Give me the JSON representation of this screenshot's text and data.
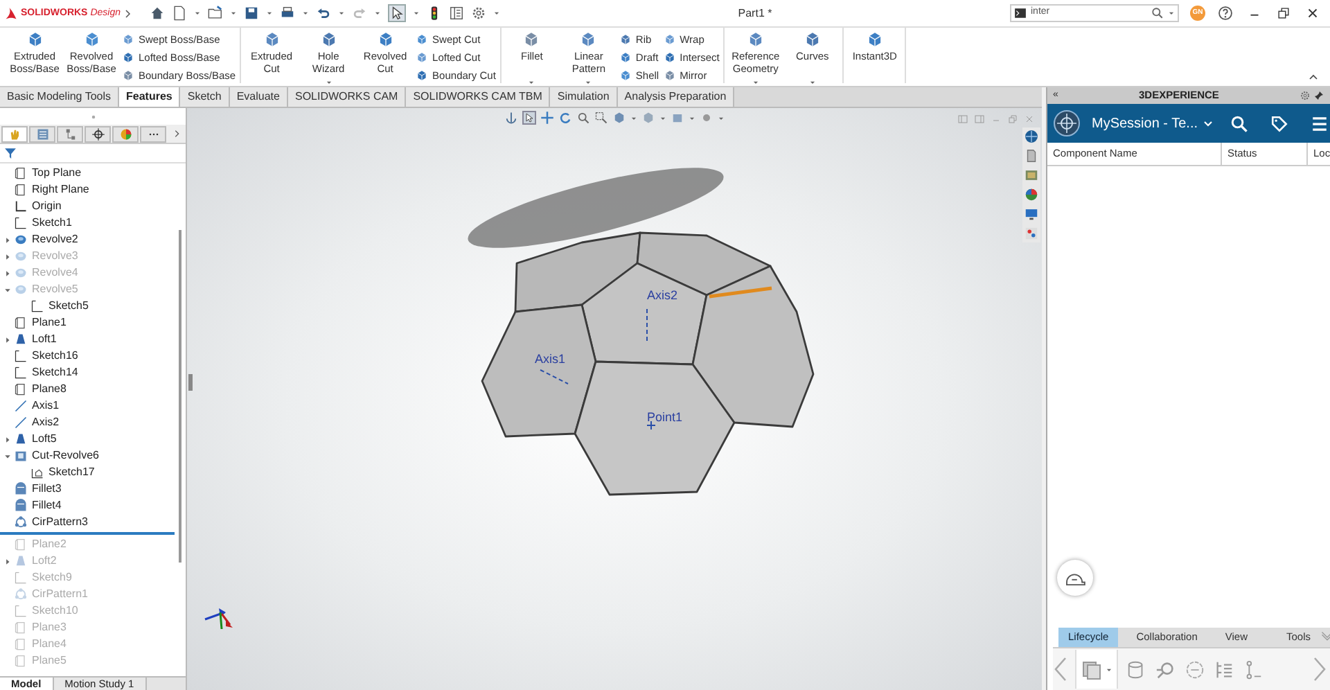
{
  "title_bar": {
    "logo": {
      "brand": "SOLIDWORKS",
      "product": "Design"
    },
    "document_title": "Part1 *",
    "search": {
      "value": "inter"
    },
    "avatar": "GN"
  },
  "ribbon": {
    "groups": [
      {
        "columns": [
          {
            "kind": "large",
            "label": "Extruded Boss/Base"
          },
          {
            "kind": "large",
            "label": "Revolved Boss/Base"
          },
          {
            "kind": "stack",
            "items": [
              "Swept Boss/Base",
              "Lofted Boss/Base",
              "Boundary Boss/Base"
            ]
          }
        ]
      },
      {
        "columns": [
          {
            "kind": "large",
            "label": "Extruded Cut"
          },
          {
            "kind": "large",
            "label": "Hole Wizard",
            "dropdown": true
          },
          {
            "kind": "large",
            "label": "Revolved Cut"
          },
          {
            "kind": "stack",
            "items": [
              "Swept Cut",
              "Lofted Cut",
              "Boundary Cut"
            ]
          }
        ]
      },
      {
        "columns": [
          {
            "kind": "large",
            "label": "Fillet",
            "dropdown": true
          },
          {
            "kind": "large",
            "label": "Linear Pattern",
            "dropdown": true
          },
          {
            "kind": "stack",
            "items": [
              "Rib",
              "Draft",
              "Shell"
            ]
          },
          {
            "kind": "stack",
            "items": [
              "Wrap",
              "Intersect",
              "Mirror"
            ]
          }
        ]
      },
      {
        "columns": [
          {
            "kind": "large",
            "label": "Reference Geometry",
            "dropdown": true
          },
          {
            "kind": "large",
            "label": "Curves",
            "dropdown": true
          }
        ]
      },
      {
        "columns": [
          {
            "kind": "large",
            "label": "Instant3D"
          }
        ]
      }
    ]
  },
  "command_tabs": [
    {
      "label": "Basic Modeling Tools",
      "selected": false
    },
    {
      "label": "Features",
      "selected": true
    },
    {
      "label": "Sketch",
      "selected": false
    },
    {
      "label": "Evaluate",
      "selected": false
    },
    {
      "label": "SOLIDWORKS CAM",
      "selected": false
    },
    {
      "label": "SOLIDWORKS CAM TBM",
      "selected": false
    },
    {
      "label": "Simulation",
      "selected": false
    },
    {
      "label": "Analysis Preparation",
      "selected": false
    }
  ],
  "panel_tabs": [
    {
      "selected": true
    },
    {
      "selected": false
    },
    {
      "selected": false
    },
    {
      "selected": false
    },
    {
      "selected": false
    },
    {
      "selected": false
    }
  ],
  "feature_tree": [
    {
      "label": "Top Plane",
      "kind": "plane",
      "greyed": false
    },
    {
      "label": "Right Plane",
      "kind": "plane",
      "greyed": false
    },
    {
      "label": "Origin",
      "kind": "origin",
      "greyed": false
    },
    {
      "label": "Sketch1",
      "kind": "sketch",
      "greyed": false
    },
    {
      "label": "Revolve2",
      "kind": "revolve",
      "greyed": false,
      "expanded": false
    },
    {
      "label": "Revolve3",
      "kind": "revolve",
      "greyed": true,
      "expanded": false
    },
    {
      "label": "Revolve4",
      "kind": "revolve",
      "greyed": true,
      "expanded": false
    },
    {
      "label": "Revolve5",
      "kind": "revolve",
      "greyed": true,
      "expanded": true,
      "children": [
        {
          "label": "Sketch5",
          "kind": "sketch",
          "greyed": false
        }
      ]
    },
    {
      "label": "Plane1",
      "kind": "plane",
      "greyed": false
    },
    {
      "label": "Loft1",
      "kind": "loft",
      "greyed": false,
      "expanded": false
    },
    {
      "label": "Sketch16",
      "kind": "sketch",
      "greyed": false
    },
    {
      "label": "Sketch14",
      "kind": "sketch",
      "greyed": false
    },
    {
      "label": "Plane8",
      "kind": "plane",
      "greyed": false
    },
    {
      "label": "Axis1",
      "kind": "axis",
      "greyed": false
    },
    {
      "label": "Axis2",
      "kind": "axis",
      "greyed": false
    },
    {
      "label": "Loft5",
      "kind": "loft",
      "greyed": false,
      "expanded": false
    },
    {
      "label": "Cut-Revolve6",
      "kind": "cut",
      "greyed": false,
      "expanded": true,
      "children": [
        {
          "label": "Sketch17",
          "kind": "sketch3d",
          "greyed": false
        }
      ]
    },
    {
      "label": "Fillet3",
      "kind": "fillet",
      "greyed": false
    },
    {
      "label": "Fillet4",
      "kind": "fillet",
      "greyed": false
    },
    {
      "label": "CirPattern3",
      "kind": "pattern",
      "greyed": false
    },
    {
      "kind": "rollback"
    },
    {
      "label": "Plane2",
      "kind": "plane",
      "greyed": true
    },
    {
      "label": "Loft2",
      "kind": "loft",
      "greyed": true,
      "expanded": false
    },
    {
      "label": "Sketch9",
      "kind": "sketch",
      "greyed": true
    },
    {
      "label": "CirPattern1",
      "kind": "pattern",
      "greyed": true
    },
    {
      "label": "Sketch10",
      "kind": "sketch",
      "greyed": true
    },
    {
      "label": "Plane3",
      "kind": "plane",
      "greyed": true
    },
    {
      "label": "Plane4",
      "kind": "plane",
      "greyed": true
    },
    {
      "label": "Plane5",
      "kind": "plane",
      "greyed": true
    }
  ],
  "bottom_tabs": [
    {
      "label": "Model",
      "selected": true
    },
    {
      "label": "Motion Study 1",
      "selected": false
    }
  ],
  "viewport": {
    "labels": [
      {
        "text": "Axis2",
        "kind": "axis"
      },
      {
        "text": "Axis1",
        "kind": "axis"
      },
      {
        "text": "Point1",
        "kind": "point"
      }
    ]
  },
  "experience_panel": {
    "collapse": "«",
    "title": "3DEXPERIENCE",
    "session": "MySession - Te...",
    "columns": [
      "Component Name",
      "Status",
      "Loc"
    ],
    "tabs": [
      {
        "label": "Lifecycle",
        "selected": true
      },
      {
        "label": "Collaboration",
        "selected": false
      },
      {
        "label": "View",
        "selected": false
      },
      {
        "label": "Tools",
        "selected": false
      }
    ]
  }
}
